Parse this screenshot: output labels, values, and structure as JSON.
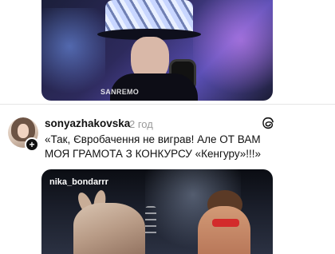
{
  "top_media": {
    "watermark": "SANREMO"
  },
  "post": {
    "username": "sonyazhakovska",
    "time": "2 год",
    "text": "«Так, Євробачення не виграв! Але ОТ ВАМ МОЯ ГРАМОТА З КОНКУРСУ «Кенгуру»!!!»",
    "follow_badge": "+",
    "embedded_media": {
      "handle": "nika_bondarrr"
    }
  },
  "icons": {
    "follow": "plus-icon",
    "platform": "threads-icon"
  }
}
